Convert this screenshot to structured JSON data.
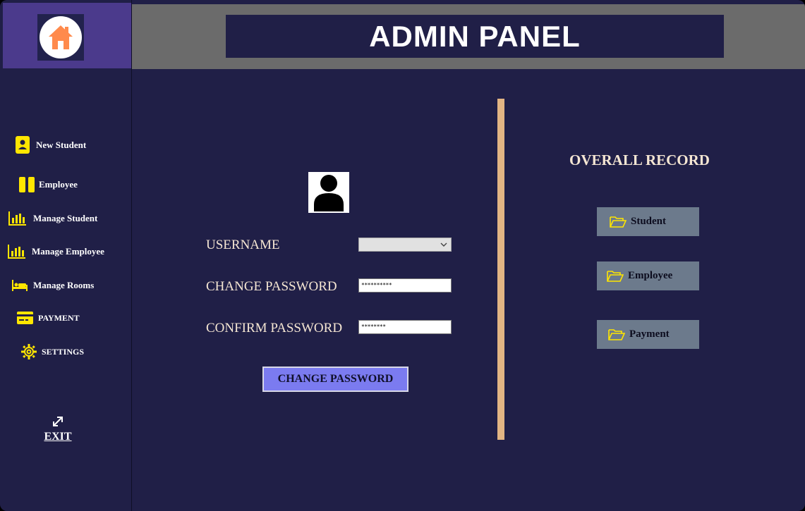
{
  "app": {
    "title": "ADMIN PANEL"
  },
  "sidebar": {
    "logo_icon": "home-icon",
    "items": [
      {
        "label": "New Student",
        "icon": "id-card-icon"
      },
      {
        "label": "Employee",
        "icon": "pause-icon"
      },
      {
        "label": "Manage Student",
        "icon": "bar-chart-icon"
      },
      {
        "label": "Manage Employee",
        "icon": "bar-chart-icon"
      },
      {
        "label": "Manage Rooms",
        "icon": "bed-icon"
      },
      {
        "label": "PAYMENT",
        "icon": "credit-card-icon"
      },
      {
        "label": "SETTINGS",
        "icon": "gear-icon"
      }
    ],
    "exit": {
      "label": "EXIT",
      "icon": "exit-arrow-icon"
    }
  },
  "form": {
    "avatar_icon": "user-icon",
    "username_label": "USERNAME",
    "username_value": "",
    "change_password_label": "CHANGE PASSWORD",
    "change_password_value": "**********",
    "confirm_password_label": "CONFIRM PASSWORD",
    "confirm_password_value": "********",
    "submit_label": "CHANGE PASSWORD"
  },
  "records": {
    "title": "OVERALL RECORD",
    "buttons": [
      {
        "label": "Student",
        "icon": "folder-open-icon"
      },
      {
        "label": "Employee",
        "icon": "folder-open-icon"
      },
      {
        "label": "Payment",
        "icon": "folder-open-icon"
      }
    ]
  },
  "colors": {
    "background": "#201f47",
    "sidebar_logo_bg": "#4b3a8c",
    "header_bg": "#6b6b6b",
    "accent_yellow": "#ffe600",
    "divider": "#e2b584",
    "button_primary": "#7b7bf0",
    "record_button": "#6c7a8c",
    "logo_orange": "#ff8a4c"
  }
}
